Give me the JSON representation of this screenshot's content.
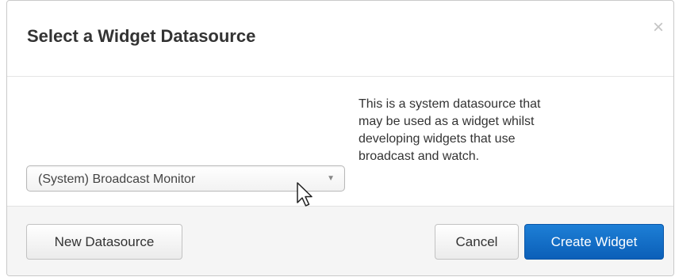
{
  "dialog": {
    "title": "Select a Widget Datasource",
    "close_glyph": "×"
  },
  "datasource_select": {
    "selected_value": "(System) Broadcast Monitor",
    "caret_glyph": "▼"
  },
  "description": {
    "lines": [
      "This is a system datasource that",
      "may be used as a widget whilst",
      "developing widgets that use",
      "broadcast and watch."
    ]
  },
  "footer": {
    "new_datasource_label": "New Datasource",
    "cancel_label": "Cancel",
    "create_widget_label": "Create Widget"
  },
  "colors": {
    "primary_button": "#0b5fb8",
    "footer_background": "#f5f5f5"
  },
  "icons": {
    "close": "close-icon",
    "caret": "chevron-down-icon",
    "cursor": "mouse-pointer-icon"
  }
}
